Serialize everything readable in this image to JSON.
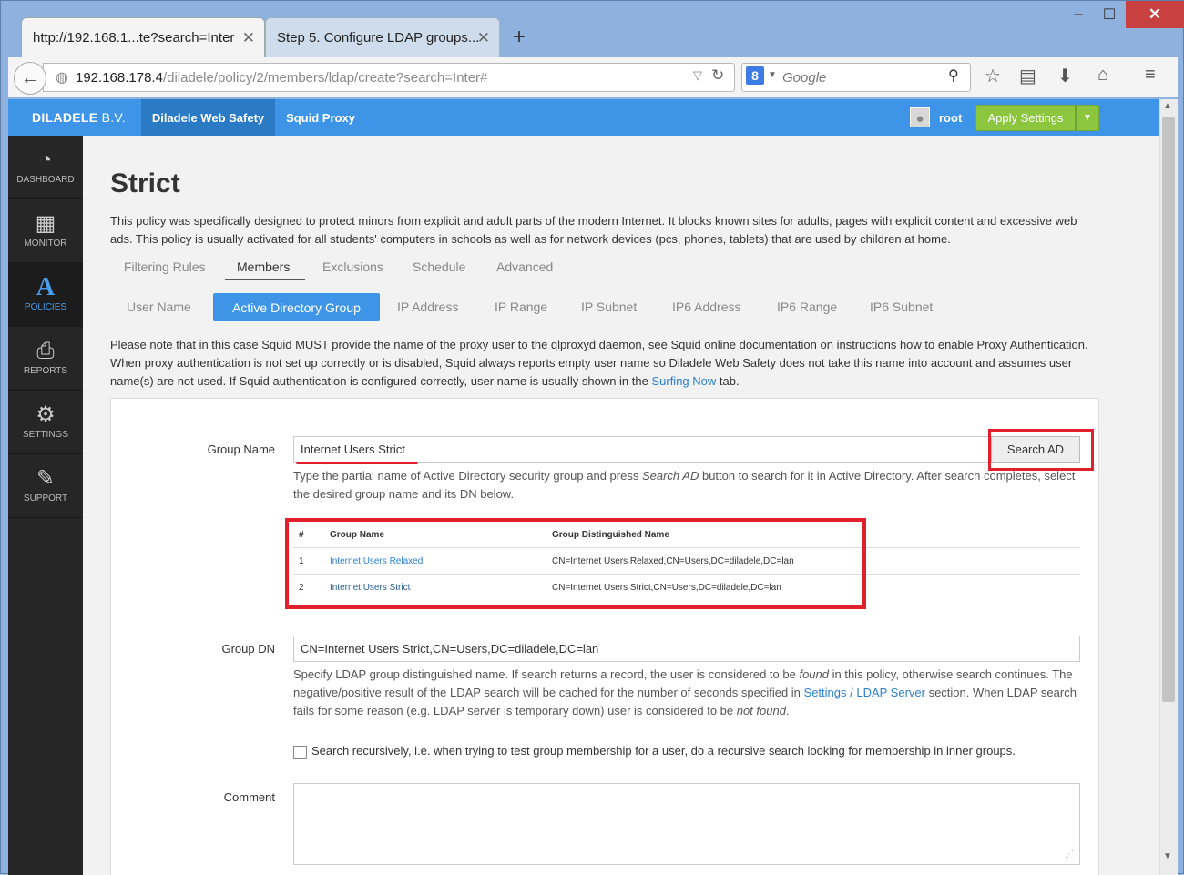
{
  "browser": {
    "tabs": [
      {
        "title": "http://192.168.1...te?search=Inter"
      },
      {
        "title": "Step 5. Configure LDAP groups..."
      }
    ],
    "url_host": "192.168.178.4",
    "url_path": "/diladele/policy/2/members/ldap/create?search=Inter#",
    "search_placeholder": "Google",
    "window_controls": {
      "minimize": "–",
      "maximize": "☐",
      "close": "✕"
    }
  },
  "app": {
    "brand_bold": "DILADELE",
    "brand_rest": " B.V.",
    "top_nav": [
      "Diladele Web Safety",
      "Squid Proxy"
    ],
    "user": "root",
    "apply_button": "Apply Settings"
  },
  "sidebar": {
    "items": [
      {
        "label": "DASHBOARD",
        "icon": "dashboard-icon"
      },
      {
        "label": "MONITOR",
        "icon": "monitor-icon"
      },
      {
        "label": "POLICIES",
        "icon": "policies-icon"
      },
      {
        "label": "REPORTS",
        "icon": "reports-icon"
      },
      {
        "label": "SETTINGS",
        "icon": "settings-icon"
      },
      {
        "label": "SUPPORT",
        "icon": "support-icon"
      }
    ],
    "active": "POLICIES"
  },
  "policy": {
    "title": "Strict",
    "description": "This policy was specifically designed to protect minors from explicit and adult parts of the modern Internet. It blocks known sites for adults, pages with explicit content and excessive web ads. This policy is usually activated for all students' computers in schools as well as for network devices (pcs, phones, tablets) that are used by children at home."
  },
  "main_tabs": [
    "Filtering Rules",
    "Members",
    "Exclusions",
    "Schedule",
    "Advanced"
  ],
  "main_tab_active": "Members",
  "sub_tabs": [
    "User Name",
    "Active Directory Group",
    "IP Address",
    "IP Range",
    "IP Subnet",
    "IP6 Address",
    "IP6 Range",
    "IP6 Subnet"
  ],
  "sub_tab_active": "Active Directory Group",
  "note": {
    "text_before": "Please note that in this case Squid MUST provide the name of the proxy user to the qlproxyd daemon, see Squid online documentation on instructions how to enable Proxy Authentication. When proxy authentication is not set up correctly or is disabled, Squid always reports empty user name so Diladele Web Safety does not take this name into account and assumes user name(s) are not used. If Squid authentication is configured correctly, user name is usually shown in the ",
    "link": "Surfing Now",
    "text_after": " tab."
  },
  "form": {
    "group_name_label": "Group Name",
    "group_name_value": "Internet Users Strict",
    "search_button": "Search AD",
    "group_name_help_1": "Type the partial name of Active Directory security group and press ",
    "group_name_help_em": "Search AD",
    "group_name_help_2": " button to search for it in Active Directory. After search completes, select the desired group name and its DN below.",
    "results": {
      "headers": [
        "#",
        "Group Name",
        "Group Distinguished Name"
      ],
      "rows": [
        {
          "num": "1",
          "name": "Internet Users Relaxed",
          "dn": "CN=Internet Users Relaxed,CN=Users,DC=diladele,DC=lan"
        },
        {
          "num": "2",
          "name": "Internet Users Strict",
          "dn": "CN=Internet Users Strict,CN=Users,DC=diladele,DC=lan"
        }
      ]
    },
    "group_dn_label": "Group DN",
    "group_dn_value": "CN=Internet Users Strict,CN=Users,DC=diladele,DC=lan",
    "group_dn_help_1": "Specify LDAP group distinguished name. If search returns a record, the user is considered to be ",
    "group_dn_help_em1": "found",
    "group_dn_help_2": " in this policy, otherwise search continues. The negative/positive result of the LDAP search will be cached for the number of seconds specified in ",
    "group_dn_help_link": "Settings / LDAP Server",
    "group_dn_help_3": " section. When LDAP search fails for some reason (e.g. LDAP server is temporary down) user is considered to be ",
    "group_dn_help_em2": "not found",
    "group_dn_help_4": ".",
    "recursive_label": "Search recursively, i.e. when trying to test group membership for a user, do a recursive search looking for membership in inner groups.",
    "recursive_checked": false,
    "comment_label": "Comment",
    "comment_value": ""
  },
  "colors": {
    "accent": "#3e95e8",
    "apply": "#8cc63e",
    "highlight": "#e0202a",
    "sidebar": "#262626"
  }
}
